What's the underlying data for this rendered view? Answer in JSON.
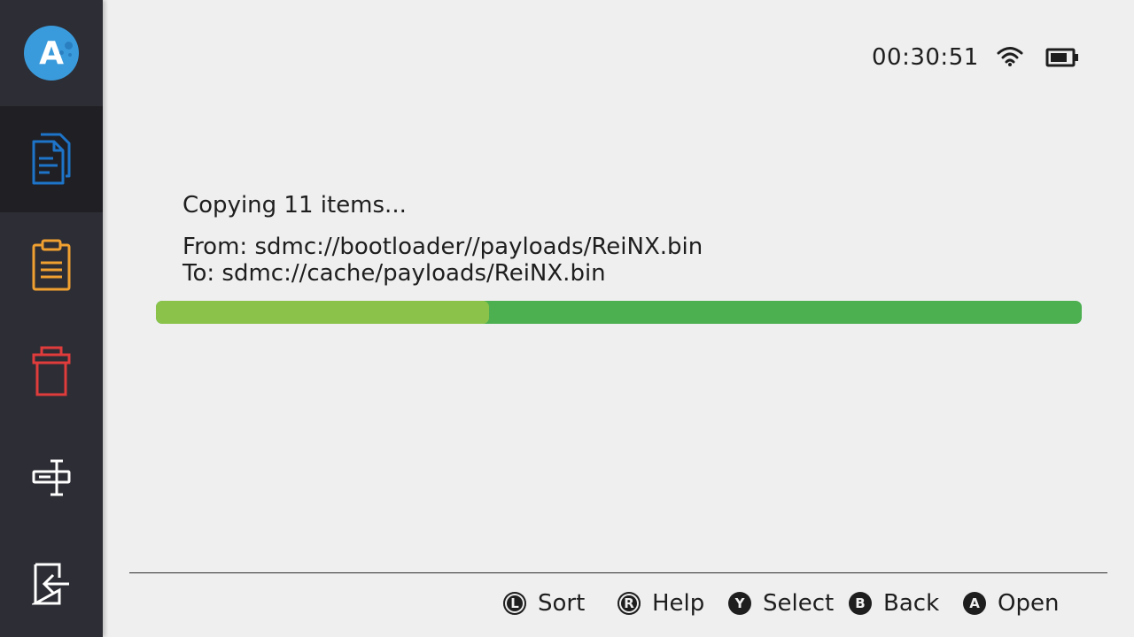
{
  "status": {
    "time": "00:30:51",
    "wifi_icon": "wifi-icon",
    "battery_icon": "battery-icon"
  },
  "sidebar": {
    "logo_letter": "A",
    "items": [
      {
        "icon": "files-icon",
        "active": true,
        "color": "#1e74c8"
      },
      {
        "icon": "clipboard-icon",
        "active": false,
        "color": "#f0a030"
      },
      {
        "icon": "trash-icon",
        "active": false,
        "color": "#e03c3c"
      },
      {
        "icon": "tools-icon",
        "active": false,
        "color": "#ffffff"
      },
      {
        "icon": "exit-icon",
        "active": false,
        "color": "#ffffff"
      }
    ]
  },
  "dialog": {
    "title": "Copying 11 items...",
    "from": "From: sdmc://bootloader//payloads/ReiNX.bin",
    "to": "To: sdmc://cache/payloads/ReiNX.bin",
    "progress": 0.36,
    "progress_fill_color": "#8bc34a",
    "progress_track_color": "#4caf50"
  },
  "footer": {
    "hints": [
      {
        "glyph": "L",
        "label": "Sort"
      },
      {
        "glyph": "R",
        "label": "Help"
      },
      {
        "glyph": "Y",
        "label": "Select"
      },
      {
        "glyph": "B",
        "label": "Back"
      },
      {
        "glyph": "A",
        "label": "Open"
      }
    ]
  }
}
